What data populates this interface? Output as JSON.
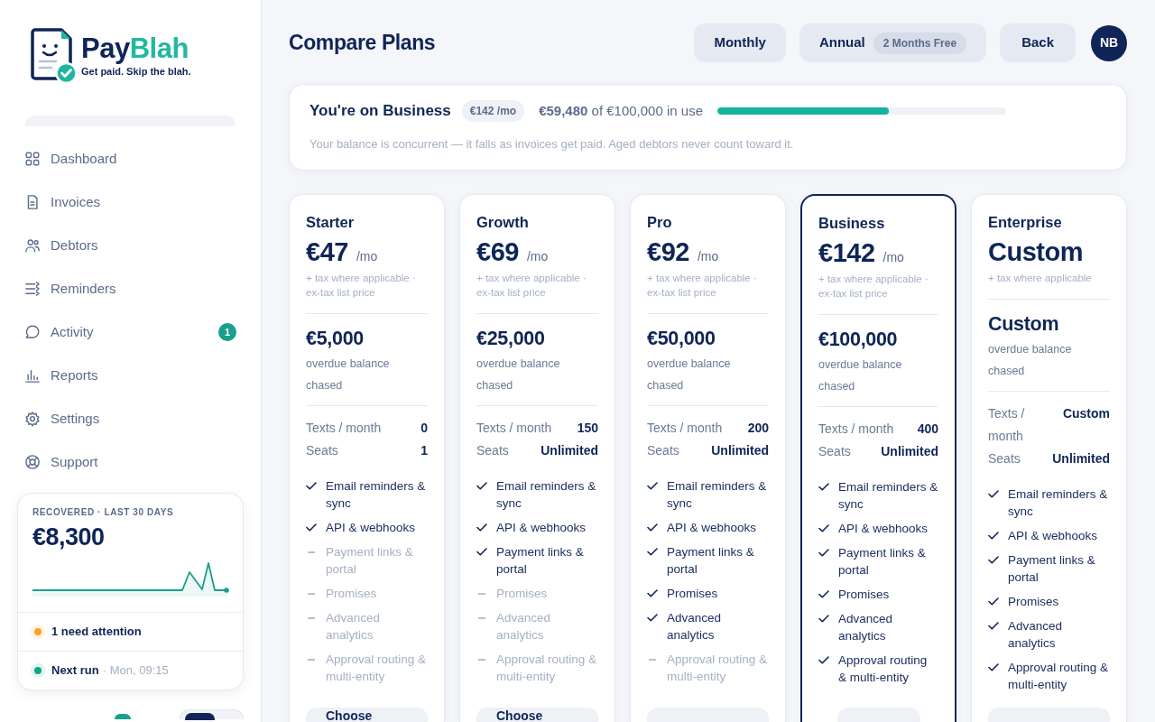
{
  "brand": {
    "name_lead": "Pay",
    "name_tail": "Blah",
    "tagline": "Get paid. Skip the blah."
  },
  "sidebar": {
    "nav": [
      {
        "label": "Dashboard",
        "selected": false
      },
      {
        "label": "Invoices",
        "selected": false
      },
      {
        "label": "Debtors",
        "selected": false
      },
      {
        "label": "Reminders",
        "selected": false
      },
      {
        "label": "Activity",
        "selected": false,
        "badge": "1"
      },
      {
        "label": "Reports",
        "selected": false
      },
      {
        "label": "Settings",
        "selected": false
      },
      {
        "label": "Support",
        "selected": false
      }
    ],
    "summary": {
      "label": "RECOVERED · LAST 30 DAYS",
      "amount": "€8,300",
      "alerts": [
        {
          "title": "1 need attention",
          "color": "#f5a524"
        },
        {
          "title": "Next run",
          "detail": "· Mon, 09:15",
          "color": "#14a38b"
        }
      ]
    }
  },
  "header": {
    "title": "Compare Plans",
    "billing_options": [
      {
        "label": "Monthly"
      },
      {
        "label": "Annual",
        "badge": "2 Months Free"
      }
    ],
    "back": "Back",
    "avatar": "NB"
  },
  "current_plan": {
    "title": "You're on Business",
    "price": "€142 /mo",
    "usage": "**€59,480** of €100,000 in use",
    "level": 0.5948,
    "note": "Your balance is concurrent — it falls as invoices get paid. Aged debtors never count toward it."
  },
  "plans": [
    {
      "name": "Starter",
      "price": "€47",
      "period": "/mo",
      "tax_note": "+ tax where applicable · ex-tax list price",
      "balance": "€5,000",
      "balance_label": "overdue balance chased",
      "limits": [
        {
          "label": "Texts / month",
          "value": "0"
        },
        {
          "label": "Seats",
          "value": "1"
        }
      ],
      "features": [
        {
          "label": "Email reminders & sync",
          "included": true
        },
        {
          "label": "API & webhooks",
          "included": true
        },
        {
          "label": "Payment links & portal",
          "included": false
        },
        {
          "label": "Promises",
          "included": false
        },
        {
          "label": "Advanced analytics",
          "included": false
        },
        {
          "label": "Approval routing & multi-entity",
          "included": false
        }
      ],
      "current": false,
      "cta": "Choose"
    },
    {
      "name": "Growth",
      "price": "€69",
      "period": "/mo",
      "tax_note": "+ tax where applicable · ex-tax list price",
      "balance": "€25,000",
      "balance_label": "overdue balance chased",
      "limits": [
        {
          "label": "Texts / month",
          "value": "150"
        },
        {
          "label": "Seats",
          "value": "Unlimited"
        }
      ],
      "features": [
        {
          "label": "Email reminders & sync",
          "included": true
        },
        {
          "label": "API & webhooks",
          "included": true
        },
        {
          "label": "Payment links & portal",
          "included": true
        },
        {
          "label": "Promises",
          "included": false
        },
        {
          "label": "Advanced analytics",
          "included": false
        },
        {
          "label": "Approval routing & multi-entity",
          "included": false
        }
      ],
      "current": false,
      "cta": "Choose"
    },
    {
      "name": "Pro",
      "price": "€92",
      "period": "/mo",
      "tax_note": "+ tax where applicable · ex-tax list price",
      "balance": "€50,000",
      "balance_label": "overdue balance chased",
      "limits": [
        {
          "label": "Texts / month",
          "value": "200"
        },
        {
          "label": "Seats",
          "value": "Unlimited"
        }
      ],
      "features": [
        {
          "label": "Email reminders & sync",
          "included": true
        },
        {
          "label": "API & webhooks",
          "included": true
        },
        {
          "label": "Payment links & portal",
          "included": true
        },
        {
          "label": "Promises",
          "included": true
        },
        {
          "label": "Advanced analytics",
          "included": true
        },
        {
          "label": "Approval routing & multi-entity",
          "included": false
        }
      ],
      "current": false
    },
    {
      "name": "Business",
      "price": "€142",
      "period": "/mo",
      "tax_note": "+ tax where applicable · ex-tax list price",
      "balance": "€100,000",
      "balance_label": "overdue balance chased",
      "limits": [
        {
          "label": "Texts / month",
          "value": "400"
        },
        {
          "label": "Seats",
          "value": "Unlimited"
        }
      ],
      "features": [
        {
          "label": "Email reminders & sync",
          "included": true
        },
        {
          "label": "API & webhooks",
          "included": true
        },
        {
          "label": "Payment links & portal",
          "included": true
        },
        {
          "label": "Promises",
          "included": true
        },
        {
          "label": "Advanced analytics",
          "included": true
        },
        {
          "label": "Approval routing & multi-entity",
          "included": true
        }
      ],
      "current": true
    },
    {
      "name": "Enterprise",
      "price": "Custom",
      "tax_note": "+ tax where applicable",
      "balance": "Custom",
      "balance_label": "overdue balance chased",
      "limits": [
        {
          "label": "Texts / month",
          "value": "Custom"
        },
        {
          "label": "Seats",
          "value": "Unlimited"
        }
      ],
      "features": [
        {
          "label": "Email reminders & sync",
          "included": true
        },
        {
          "label": "API & webhooks",
          "included": true
        },
        {
          "label": "Payment links & portal",
          "included": true
        },
        {
          "label": "Promises",
          "included": true
        },
        {
          "label": "Advanced analytics",
          "included": true
        },
        {
          "label": "Approval routing & multi-entity",
          "included": true
        }
      ],
      "current": false
    }
  ]
}
